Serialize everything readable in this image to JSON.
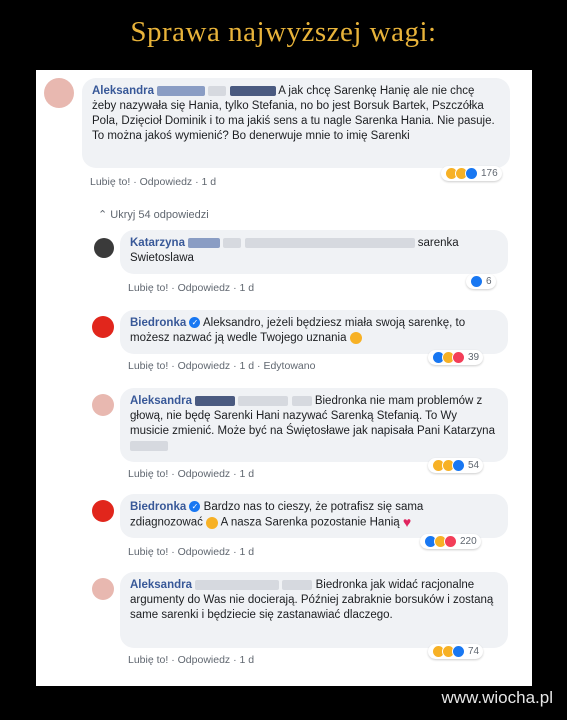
{
  "title": "Sprawa najwyższej wagi:",
  "watermark": "www.wiocha.pl",
  "toggle_replies": "Ukryj 54 odpowiedzi",
  "comments": [
    {
      "author": "Aleksandra",
      "text": "A jak chcę Sarenkę Hanię ale nie chcę żeby nazywała się Hania, tylko Stefania, no bo jest Borsuk Bartek, Pszczółka Pola, Dzięcioł Dominik i to ma jakiś sens a tu nagle Sarenka Hania. Nie pasuje. To można jakoś wymienić? Bo denerwuje mnie to imię Sarenki",
      "like": "Lubię to!",
      "reply": "Odpowiedz",
      "time": "1 d",
      "reactions_count": "176"
    },
    {
      "author": "Katarzyna",
      "text_after": "sarenka",
      "text_line2": "Swietoslawa",
      "like": "Lubię to!",
      "reply": "Odpowiedz",
      "time": "1 d",
      "reactions_count": "6"
    },
    {
      "author": "Biedronka",
      "text": "Aleksandro, jeżeli będziesz miała swoją sarenkę, to możesz nazwać ją wedle Twojego uznania",
      "like": "Lubię to!",
      "reply": "Odpowiedz",
      "time": "1 d",
      "edited": "Edytowano",
      "reactions_count": "39"
    },
    {
      "author": "Aleksandra",
      "text_head": "Biedronka nie mam",
      "text": "problemów z głową, nie będę Sarenki Hani nazywać Sarenką Stefanią. To Wy musicie zmienić. Może być na Świętosławe jak napisała Pani Katarzyna",
      "like": "Lubię to!",
      "reply": "Odpowiedz",
      "time": "1 d",
      "reactions_count": "54"
    },
    {
      "author": "Biedronka",
      "text": "Bardzo nas to cieszy, że potrafisz się sama zdiagnozować",
      "text_tail": "A nasza Sarenka pozostanie Hanią",
      "like": "Lubię to!",
      "reply": "Odpowiedz",
      "time": "1 d",
      "reactions_count": "220"
    },
    {
      "author": "Aleksandra",
      "text_head": "Biedronka jak",
      "text": "widać racjonalne argumenty do Was nie docierają. Później zabraknie borsuków i zostaną same sarenki i będziecie się zastanawiać dlaczego.",
      "like": "Lubię to!",
      "reply": "Odpowiedz",
      "time": "1 d",
      "reactions_count": "74"
    }
  ],
  "colors": {
    "title": "#e8b33a",
    "author": "#385898",
    "bubble": "#f0f2f5",
    "meta": "#606770"
  }
}
